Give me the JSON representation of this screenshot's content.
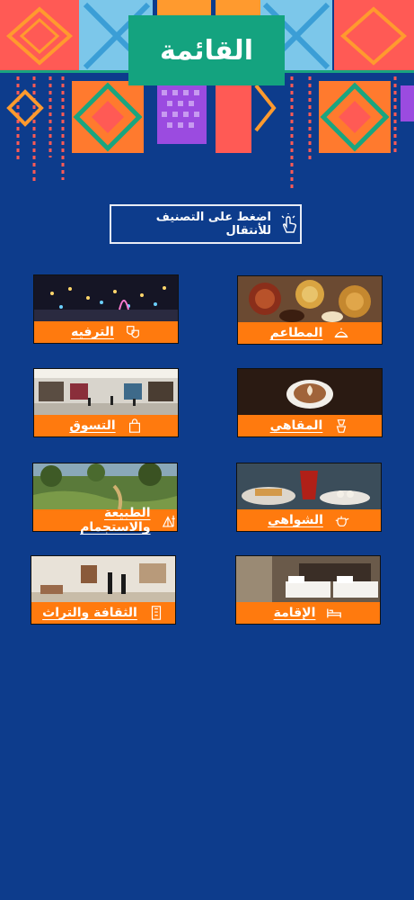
{
  "header": {
    "title": "القائمة"
  },
  "hint": {
    "text": "اضغط على التصنيف للأنتقال"
  },
  "categories": [
    {
      "label": "المطاعم",
      "icon": "restaurant-icon"
    },
    {
      "label": "الترفيه",
      "icon": "theater-masks-icon"
    },
    {
      "label": "المقاهي",
      "icon": "coffee-maker-icon"
    },
    {
      "label": "التسوق",
      "icon": "shopping-bag-icon"
    },
    {
      "label": "الشواهي",
      "icon": "teapot-icon"
    },
    {
      "label": "الطبيعة والاستجمام",
      "icon": "nature-camping-icon"
    },
    {
      "label": "الإقامة",
      "icon": "bed-icon"
    },
    {
      "label": "الثقافة والتراث",
      "icon": "heritage-building-icon"
    }
  ],
  "colors": {
    "background": "#0d3c8c",
    "accent": "#ff7a0e",
    "title_box": "#14a37f"
  }
}
